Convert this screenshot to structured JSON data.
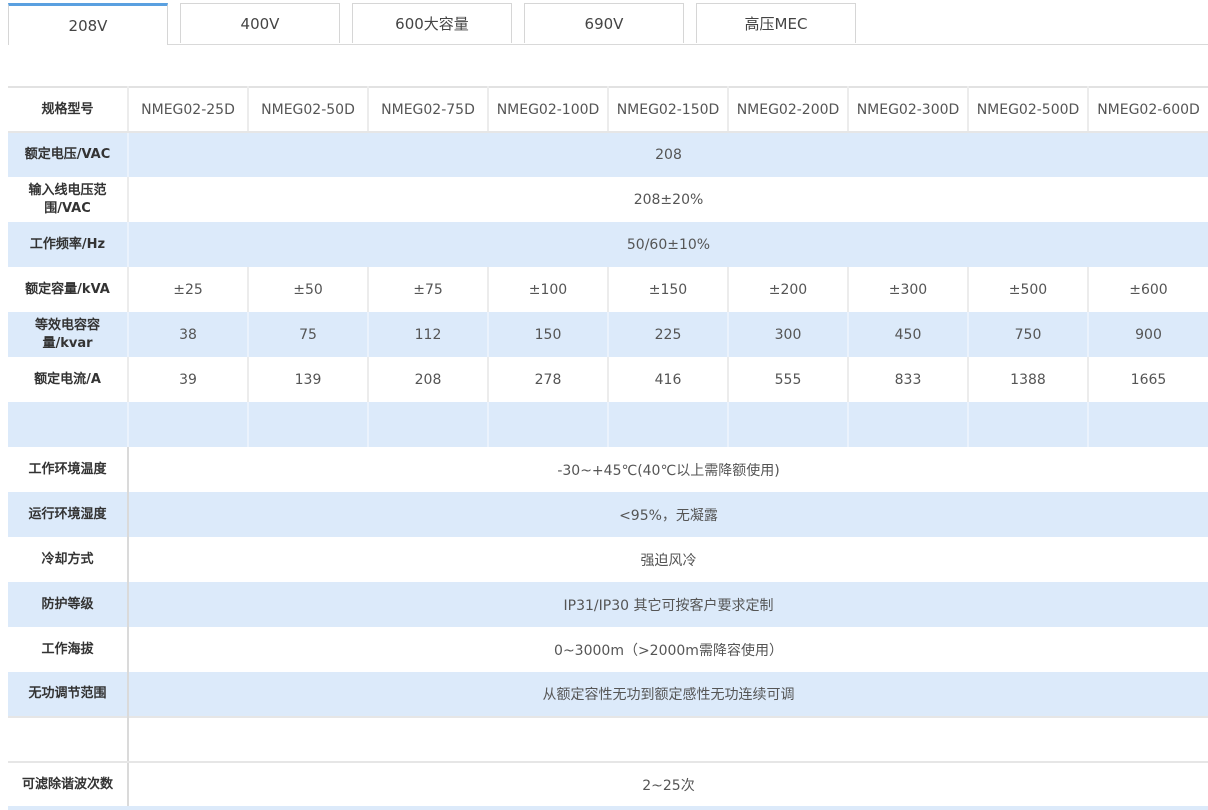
{
  "tabs": [
    {
      "label": "208V",
      "active": true
    },
    {
      "label": "400V",
      "active": false
    },
    {
      "label": "600大容量",
      "active": false
    },
    {
      "label": "690V",
      "active": false
    },
    {
      "label": "高压MEC",
      "active": false
    }
  ],
  "table": {
    "header_label": "规格型号",
    "models": [
      "NMEG02-25D",
      "NMEG02-50D",
      "NMEG02-75D",
      "NMEG02-100D",
      "NMEG02-150D",
      "NMEG02-200D",
      "NMEG02-300D",
      "NMEG02-500D",
      "NMEG02-600D"
    ],
    "rated_voltage": {
      "label": "额定电压/VAC",
      "value": "208"
    },
    "input_voltage_range": {
      "label": "输入线电压范围/VAC",
      "value": "208±20%"
    },
    "frequency": {
      "label": "工作频率/Hz",
      "value": "50/60±10%"
    },
    "rated_capacity": {
      "label": "额定容量/kVA",
      "values": [
        "±25",
        "±50",
        "±75",
        "±100",
        "±150",
        "±200",
        "±300",
        "±500",
        "±600"
      ]
    },
    "equivalent_capacitance": {
      "label": "等效电容容量/kvar",
      "values": [
        "38",
        "75",
        "112",
        "150",
        "225",
        "300",
        "450",
        "750",
        "900"
      ]
    },
    "rated_current": {
      "label": "额定电流/A",
      "values": [
        "39",
        "139",
        "208",
        "278",
        "416",
        "555",
        "833",
        "1388",
        "1665"
      ]
    },
    "ambient_temperature": {
      "label": "工作环境温度",
      "value": "-30~+45℃(40℃以上需降额使用)"
    },
    "humidity": {
      "label": "运行环境湿度",
      "value": "<95%，无凝露"
    },
    "cooling": {
      "label": "冷却方式",
      "value": "强迫风冷"
    },
    "protection": {
      "label": "防护等级",
      "value": "IP31/IP30 其它可按客户要求定制"
    },
    "altitude": {
      "label": "工作海拔",
      "value": "0~3000m（>2000m需降容使用）"
    },
    "reactive_range": {
      "label": "无功调节范围",
      "value": "从额定容性无功到额定感性无功连续可调"
    },
    "harmonic_orders": {
      "label": "可滤除谐波次数",
      "value": "2~25次"
    }
  },
  "colors": {
    "row_alt": "#dceafa",
    "tab_active_border": "#5aa0e0"
  }
}
